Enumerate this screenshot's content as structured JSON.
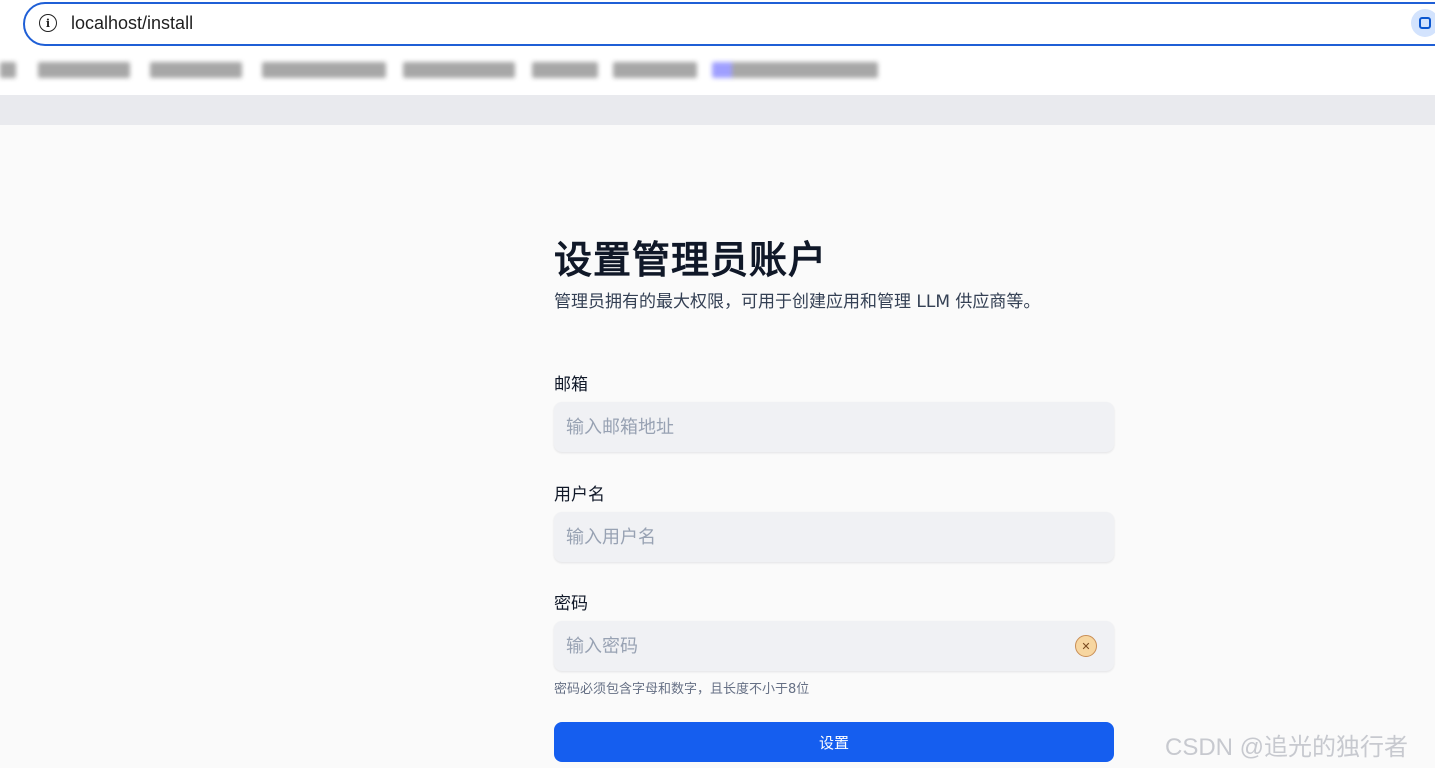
{
  "browser": {
    "url": "localhost/install",
    "bookmarks_blurred": true,
    "bookmark_tints": [
      "#8a8a8a",
      "#8a8a8a",
      "#8a8a8a",
      "#8a8a8a",
      "#8a8a8a",
      "#8a8a8a",
      "#8a8a8a",
      "#8080ff"
    ]
  },
  "page": {
    "title": "设置管理员账户",
    "subtitle": "管理员拥有的最大权限，可用于创建应用和管理 LLM 供应商等。"
  },
  "form": {
    "email_label": "邮箱",
    "email_placeholder": "输入邮箱地址",
    "username_label": "用户名",
    "username_placeholder": "输入用户名",
    "password_label": "密码",
    "password_placeholder": "输入密码",
    "password_hint": "密码必须包含字母和数字，且长度不小于8位",
    "submit_label": "设置"
  },
  "watermark": "CSDN @追光的独行者",
  "colors": {
    "primary": "#155eef",
    "field_bg": "#f0f1f4",
    "page_bg": "#fafafa"
  }
}
